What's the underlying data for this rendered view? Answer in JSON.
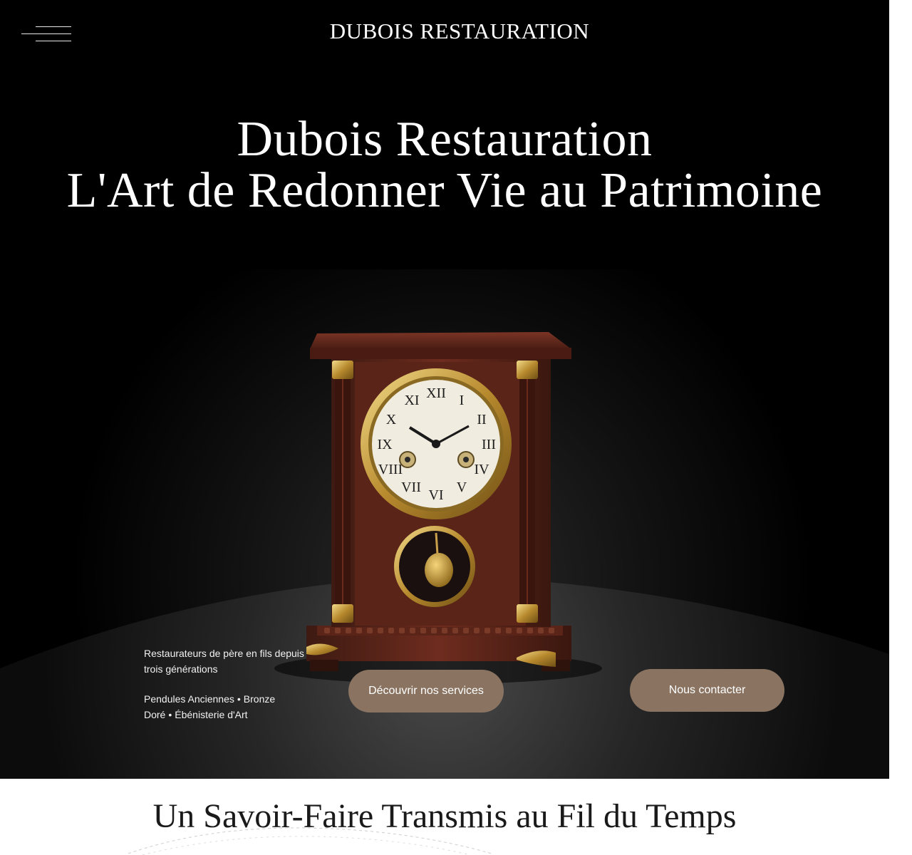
{
  "header": {
    "brand": "DUBOIS RESTAURATION",
    "menu_icon": "hamburger-menu-icon"
  },
  "hero": {
    "title_line1": "Dubois Restauration",
    "title_line2": "L'Art de Redonner Vie au Patrimoine",
    "tagline": "Restaurateurs de père en fils depuis trois générations",
    "specialties": [
      "Pendules Anciennes",
      "Bronze Doré",
      "Ébénisterie d'Art"
    ],
    "separator": "•",
    "image": "antique-mantel-clock-photo"
  },
  "buttons": {
    "services": "Découvrir nos services",
    "contact": "Nous contacter"
  },
  "section": {
    "title": "Un Savoir-Faire Transmis au Fil du Temps"
  },
  "colors": {
    "hero_background": "#000000",
    "button_background": "#8a7461",
    "text_light": "#ffffff",
    "text_dark": "#1a1a1a"
  }
}
